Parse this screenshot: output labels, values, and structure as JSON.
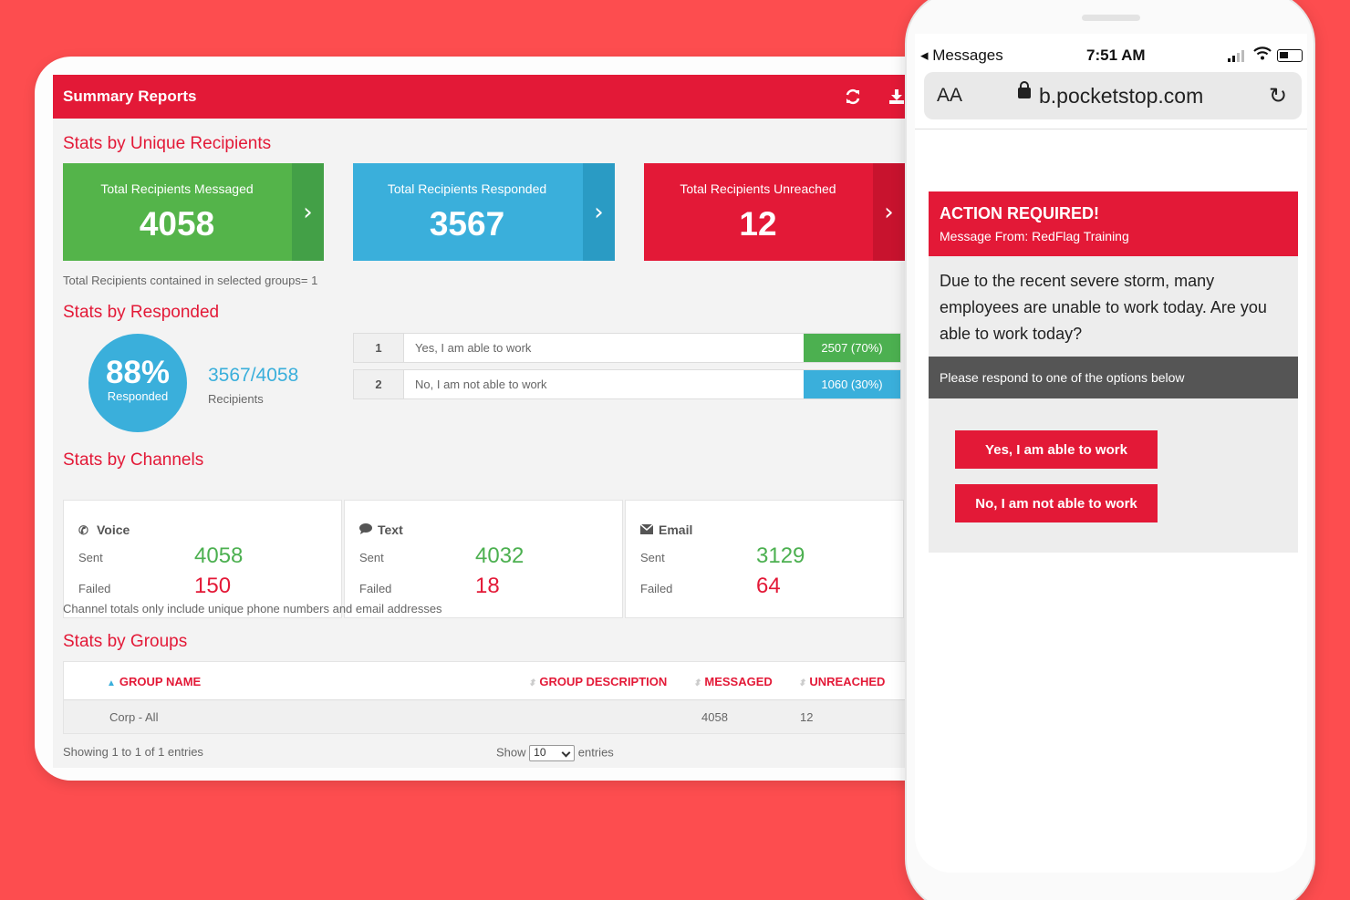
{
  "header": {
    "title": "Summary Reports",
    "refresh_icon": "refresh-icon",
    "download_icon": "download-icon"
  },
  "unique": {
    "title": "Stats by Unique Recipients",
    "cards": [
      {
        "label": "Total Recipients Messaged",
        "value": "4058",
        "color": "#54b44a",
        "arrow_color": "#43a047"
      },
      {
        "label": "Total Recipients Responded",
        "value": "3567",
        "color": "#3aafdb",
        "arrow_color": "#2a9bc4"
      },
      {
        "label": "Total Recipients Unreached",
        "value": "12",
        "color": "#e31937",
        "arrow_color": "#c8132e"
      }
    ],
    "note": "Total Recipients contained in selected groups= 1"
  },
  "responded": {
    "title": "Stats by Responded",
    "percent": "88%",
    "percent_label": "Responded",
    "ratio": "3567/4058",
    "ratio_label": "Recipients",
    "rows": [
      {
        "num": "1",
        "text": "Yes, I am able to work",
        "count": "2507 (70%)",
        "color": "#4cb050"
      },
      {
        "num": "2",
        "text": "No, I am not able to work",
        "count": "1060 (30%)",
        "color": "#3aafdb"
      }
    ]
  },
  "channels": {
    "title": "Stats by Channels",
    "sent_label": "Sent",
    "failed_label": "Failed",
    "items": [
      {
        "name": "Voice",
        "icon": "phone-icon",
        "sent": "4058",
        "failed": "150"
      },
      {
        "name": "Text",
        "icon": "chat-bubble-icon",
        "sent": "4032",
        "failed": "18"
      },
      {
        "name": "Email",
        "icon": "envelope-icon",
        "sent": "3129",
        "failed": "64"
      }
    ],
    "note": "Channel totals only include unique phone numbers and email addresses"
  },
  "groups": {
    "title": "Stats by Groups",
    "columns": [
      "GROUP NAME",
      "GROUP DESCRIPTION",
      "MESSAGED",
      "UNREACHED"
    ],
    "rows": [
      {
        "name": "Corp - All",
        "description": "",
        "messaged": "4058",
        "unreached": "12"
      }
    ],
    "showing": "Showing 1 to 1 of 1 entries",
    "show_label": "Show",
    "show_value": "10",
    "entries_label": "entries"
  },
  "phone": {
    "status": {
      "back": "◂ Messages",
      "time": "7:51 AM"
    },
    "browser": {
      "text_size": "AA",
      "url": "b.pocketstop.com"
    },
    "message": {
      "title": "ACTION REQUIRED!",
      "from": "Message From: RedFlag Training",
      "body": "Due to the recent severe storm, many employees are unable to work today. Are you able to work today?",
      "prompt": "Please respond to one of the options below",
      "options": [
        "Yes, I am able to work",
        "No, I am not able to work"
      ]
    }
  }
}
